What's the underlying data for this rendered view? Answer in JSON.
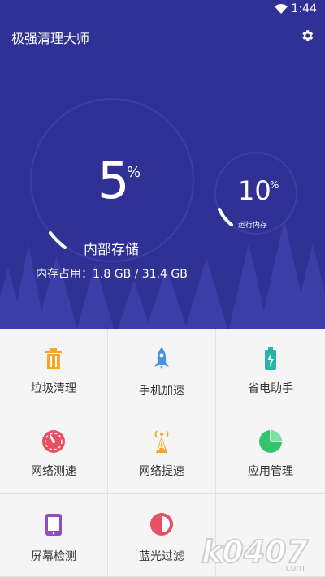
{
  "status": {
    "time": "1:44"
  },
  "app": {
    "title": "极强清理大师"
  },
  "storage": {
    "percent": "5",
    "percent_sign": "%",
    "label": "内部存储",
    "usage": "内存占用：1.8 GB / 31.4 GB"
  },
  "ram": {
    "percent": "10",
    "percent_sign": "%",
    "label": "运行内存"
  },
  "menu": [
    {
      "label": "垃圾清理",
      "icon": "trash-icon",
      "color": "#f6a623"
    },
    {
      "label": "手机加速",
      "icon": "rocket-icon",
      "color": "#4a90e2"
    },
    {
      "label": "省电助手",
      "icon": "battery-icon",
      "color": "#26b5a8"
    },
    {
      "label": "网络测速",
      "icon": "speedometer-icon",
      "color": "#e94f63"
    },
    {
      "label": "网络提速",
      "icon": "signal-tower-icon",
      "color": "#f6a623"
    },
    {
      "label": "应用管理",
      "icon": "pie-chart-icon",
      "color": "#34c46b"
    },
    {
      "label": "屏幕检测",
      "icon": "tablet-icon",
      "color": "#8e4ec6"
    },
    {
      "label": "蓝光过滤",
      "icon": "half-circle-icon",
      "color": "#e94f63"
    }
  ],
  "watermark": {
    "text": "k0407.com"
  },
  "colors": {
    "hero": "#2f3294",
    "trees": "#3a3ea6"
  }
}
